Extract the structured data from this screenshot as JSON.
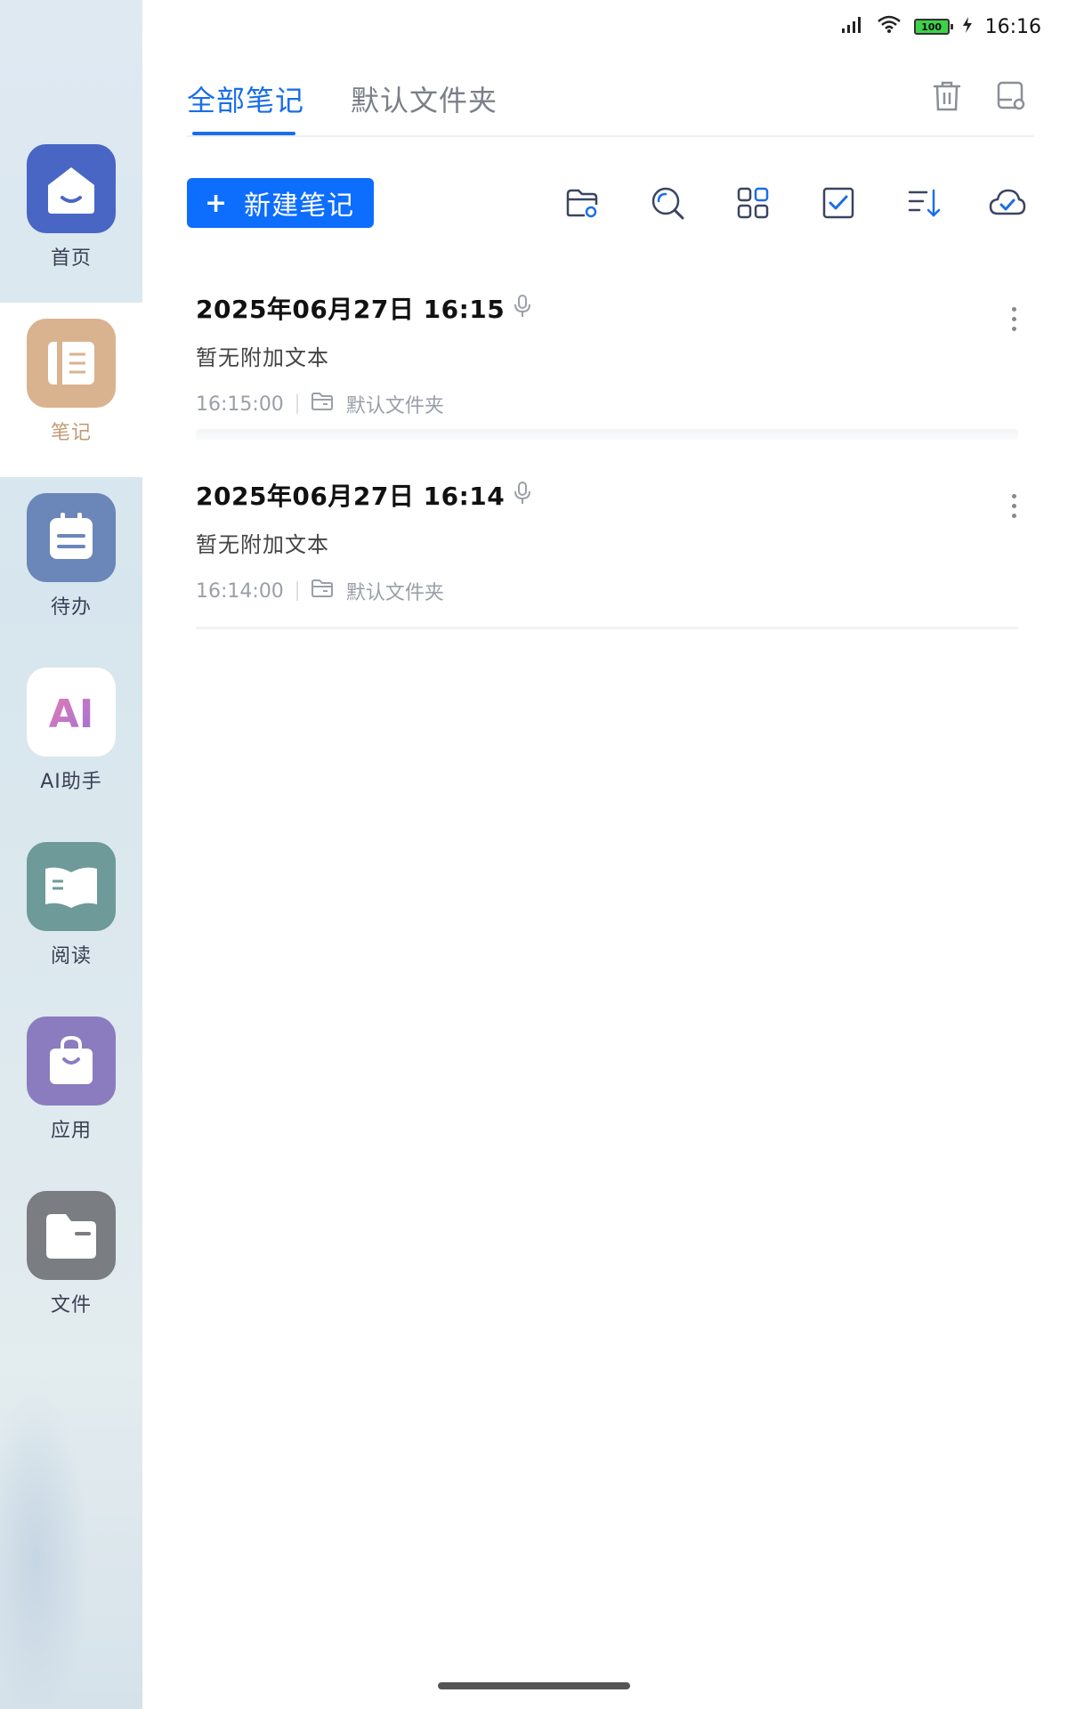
{
  "status_bar": {
    "battery": "100",
    "time": "16:16"
  },
  "sidebar": {
    "items": [
      {
        "label": "首页",
        "icon": "home-icon",
        "color": "#4a66c4"
      },
      {
        "label": "笔记",
        "icon": "notebook-icon",
        "color": "#d9b38f"
      },
      {
        "label": "待办",
        "icon": "todo-icon",
        "color": "#6b86b8"
      },
      {
        "label": "AI助手",
        "icon": "ai-icon",
        "color": "#ffffff",
        "text": "AI"
      },
      {
        "label": "阅读",
        "icon": "book-icon",
        "color": "#6e9a9a"
      },
      {
        "label": "应用",
        "icon": "bag-icon",
        "color": "#8b7cbf"
      },
      {
        "label": "文件",
        "icon": "folder-icon",
        "color": "#7a7d82"
      }
    ],
    "active_index": 1
  },
  "header": {
    "tabs": [
      {
        "label": "全部笔记",
        "active": true
      },
      {
        "label": "默认文件夹",
        "active": false
      }
    ]
  },
  "toolbar": {
    "new_note_label": "新建笔记",
    "new_note_plus": "+",
    "accent": "#0d6efd"
  },
  "notes": [
    {
      "title": "2025年06月27日 16:15",
      "body": "暂无附加文本",
      "time": "16:15:00",
      "folder": "默认文件夹"
    },
    {
      "title": "2025年06月27日 16:14",
      "body": "暂无附加文本",
      "time": "16:14:00",
      "folder": "默认文件夹"
    }
  ]
}
